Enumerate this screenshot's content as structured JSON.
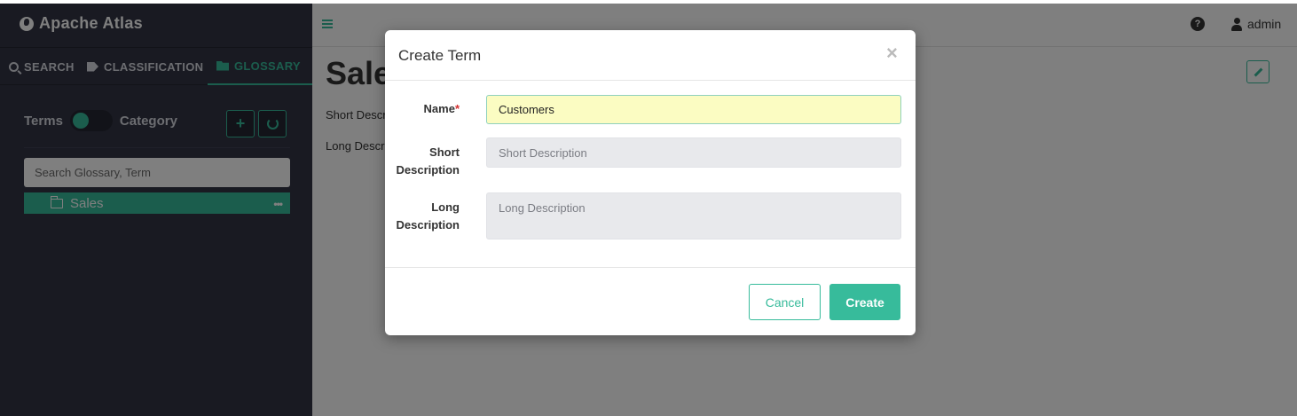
{
  "sidebar": {
    "brand": "Apache Atlas",
    "tabs": [
      {
        "label": "SEARCH"
      },
      {
        "label": "CLASSIFICATION"
      },
      {
        "label": "GLOSSARY"
      }
    ],
    "toggle_left": "Terms",
    "toggle_right": "Category",
    "add_label": "+",
    "search_placeholder": "Search Glossary, Term",
    "tree": [
      {
        "label": "Sales",
        "menu": "•••"
      }
    ]
  },
  "topbar": {
    "help_glyph": "?",
    "user_name": "admin"
  },
  "page": {
    "title": "Sales",
    "short_description_label": "Short Description",
    "long_description_label": "Long Description"
  },
  "modal": {
    "title": "Create Term",
    "close_glyph": "×",
    "name_label": "Name",
    "required_mark": "*",
    "name_value": "Customers",
    "short_label": "Short Description",
    "short_placeholder": "Short Description",
    "long_label": "Long Description",
    "long_placeholder": "Long Description",
    "cancel_label": "Cancel",
    "create_label": "Create"
  },
  "colors": {
    "accent": "#37bb9b",
    "sidebar_bg": "#323544",
    "name_field_bg": "#fbfcc2"
  }
}
